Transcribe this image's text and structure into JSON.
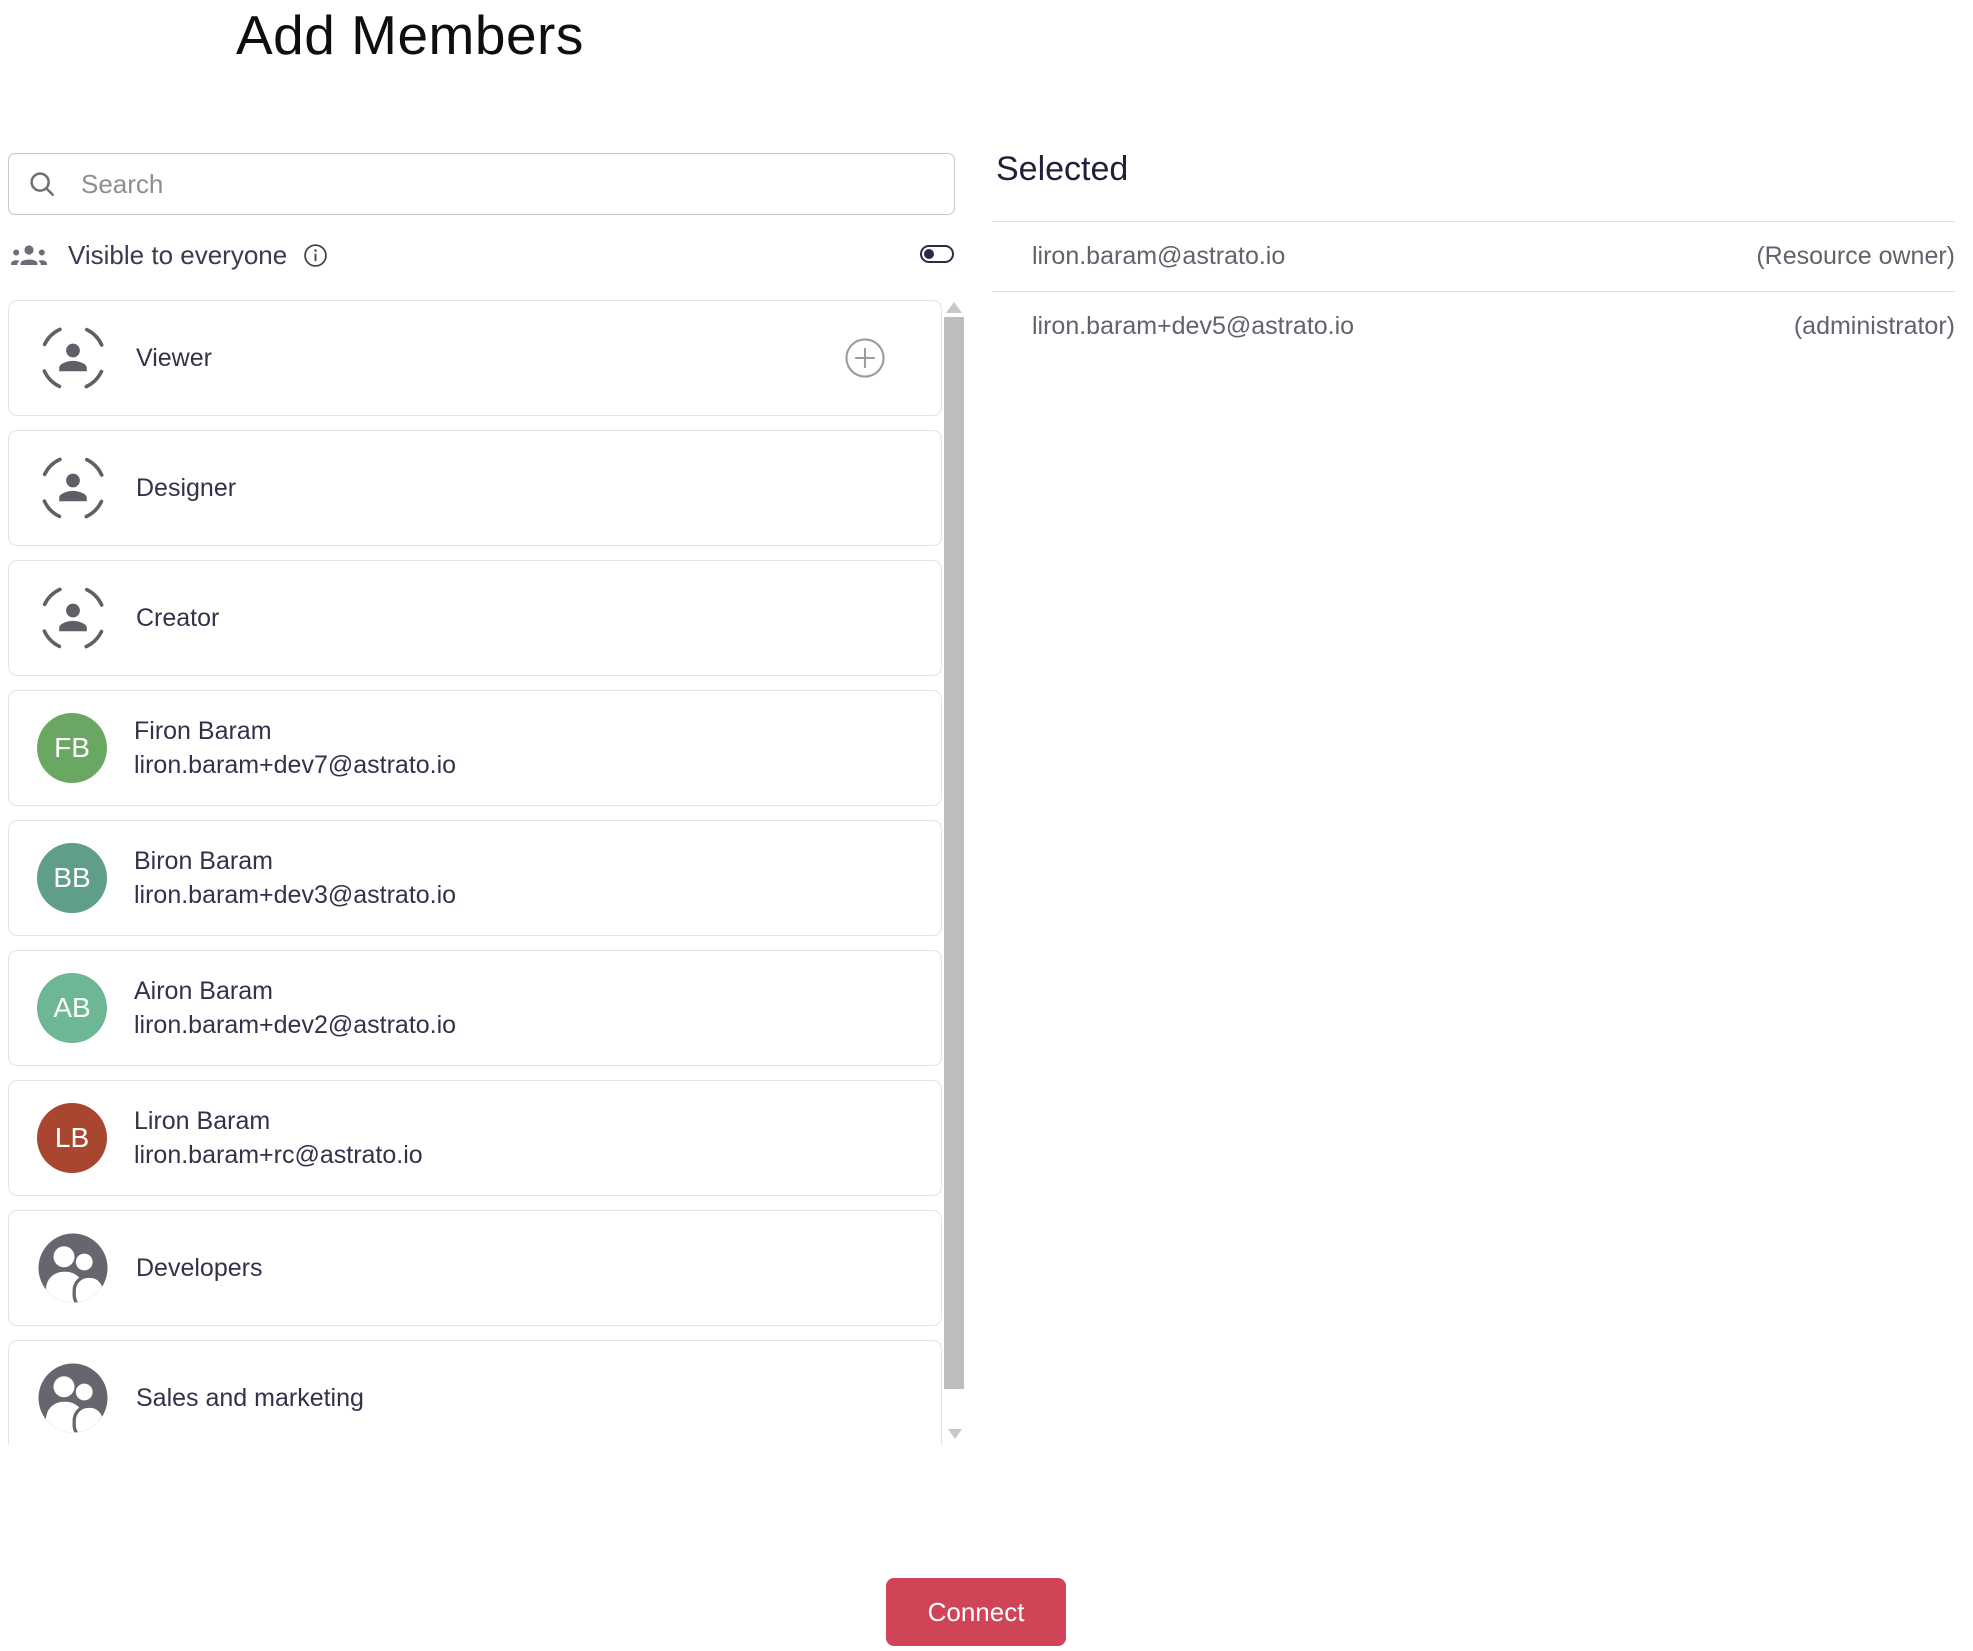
{
  "title": "Add Members",
  "search": {
    "placeholder": "Search"
  },
  "visibility": {
    "label": "Visible to everyone",
    "toggle_on": false
  },
  "members": [
    {
      "type": "role",
      "label": "Viewer",
      "has_add_button": true
    },
    {
      "type": "role",
      "label": "Designer"
    },
    {
      "type": "role",
      "label": "Creator"
    },
    {
      "type": "user",
      "name": "Firon Baram",
      "email": "liron.baram+dev7@astrato.io",
      "initials": "FB",
      "avatar_color": "#6aa763"
    },
    {
      "type": "user",
      "name": "Biron Baram",
      "email": "liron.baram+dev3@astrato.io",
      "initials": "BB",
      "avatar_color": "#5f9e88"
    },
    {
      "type": "user",
      "name": "Airon Baram",
      "email": "liron.baram+dev2@astrato.io",
      "initials": "AB",
      "avatar_color": "#6db795"
    },
    {
      "type": "user",
      "name": "Liron Baram",
      "email": "liron.baram+rc@astrato.io",
      "initials": "LB",
      "avatar_color": "#a8462f"
    },
    {
      "type": "group",
      "label": "Developers"
    },
    {
      "type": "group",
      "label": "Sales and marketing"
    }
  ],
  "selected": {
    "heading": "Selected",
    "rows": [
      {
        "email": "liron.baram@astrato.io",
        "role": "(Resource owner)"
      },
      {
        "email": "liron.baram+dev5@astrato.io",
        "role": "(administrator)"
      }
    ]
  },
  "footer": {
    "connect_label": "Connect"
  },
  "colors": {
    "accent_red": "#d04458",
    "toggle": "#2b2b45",
    "group_avatar_gray": "#66666e",
    "icon_gray": "#6d6d78"
  }
}
